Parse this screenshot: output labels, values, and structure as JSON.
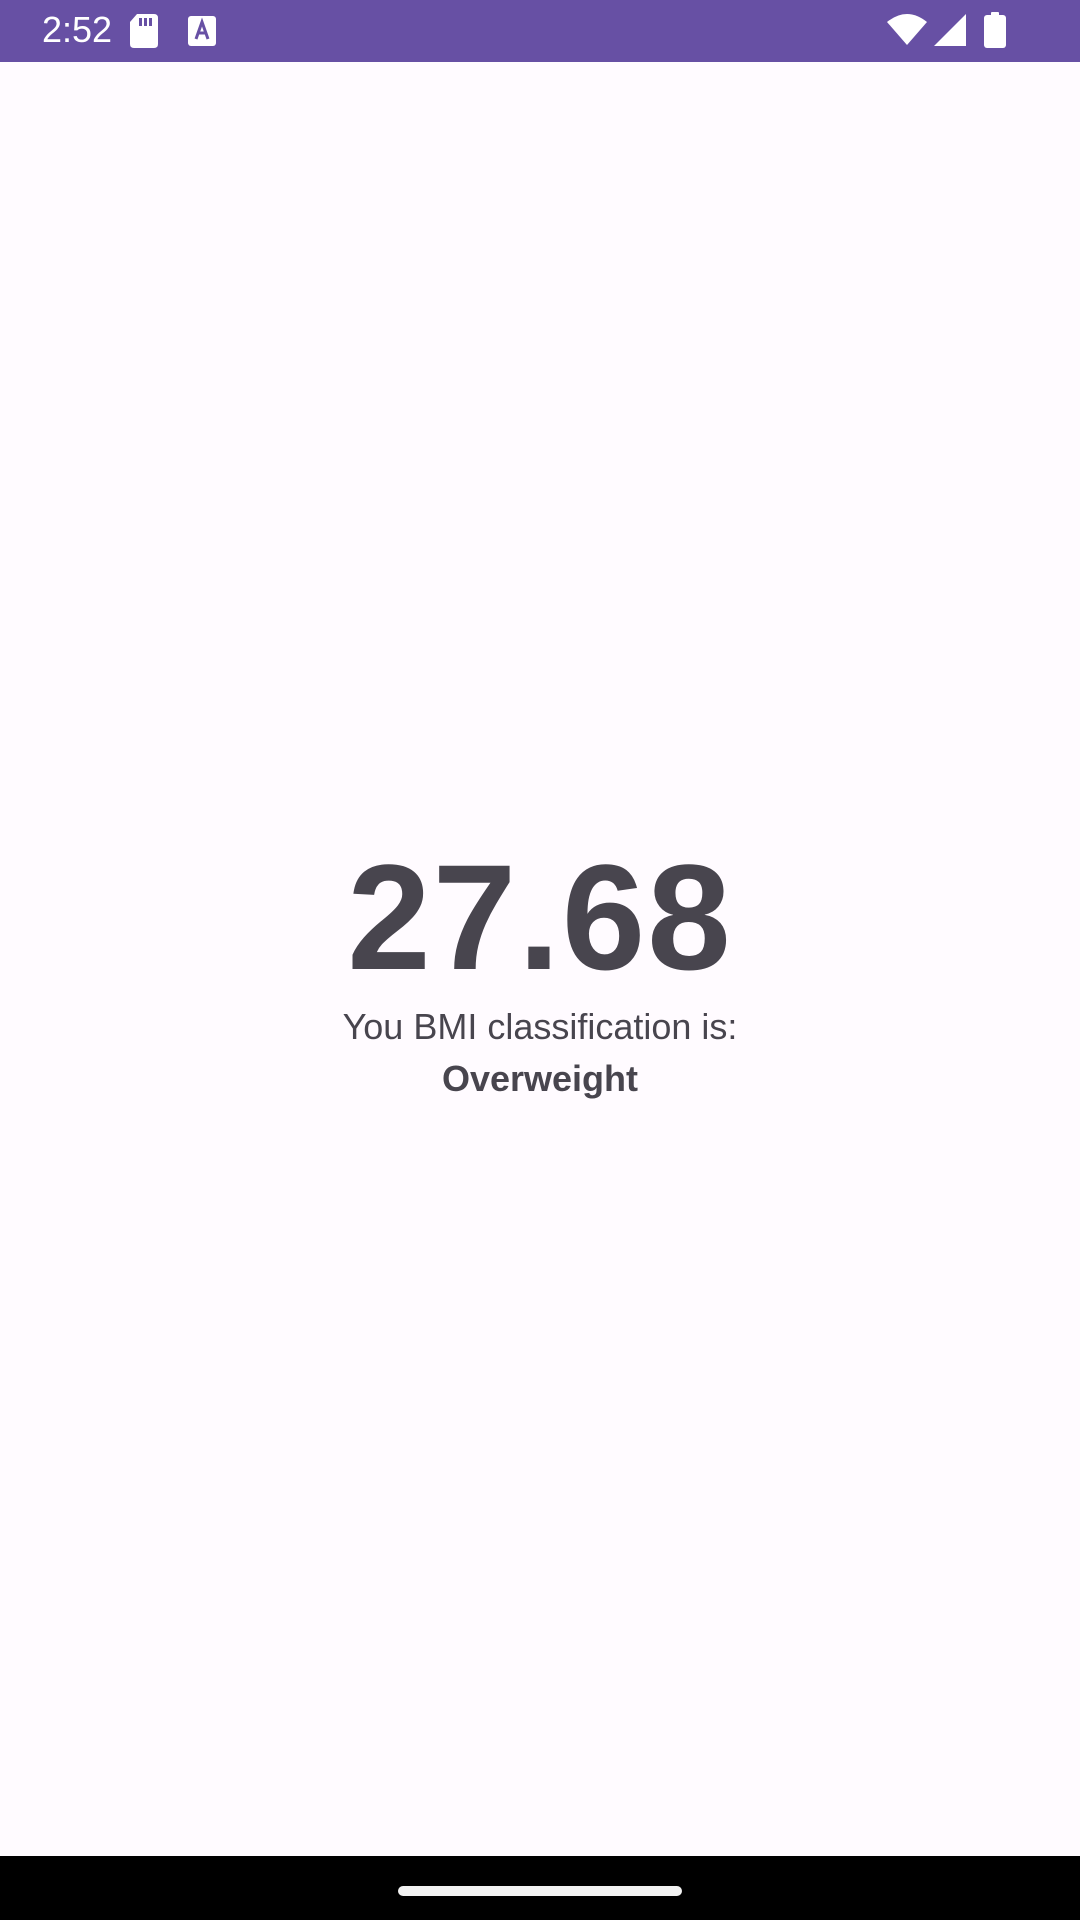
{
  "status_bar": {
    "time": "2:52",
    "background": "#6750a4",
    "icons": [
      "sd-card-icon",
      "a-icon",
      "wifi-icon",
      "signal-icon",
      "battery-icon"
    ]
  },
  "result": {
    "bmi_value": "27.68",
    "classification_label": "You BMI classification is:",
    "classification_value": "Overweight",
    "text_color": "#48454e"
  },
  "navigation": {
    "home_handle": "home-indicator"
  }
}
